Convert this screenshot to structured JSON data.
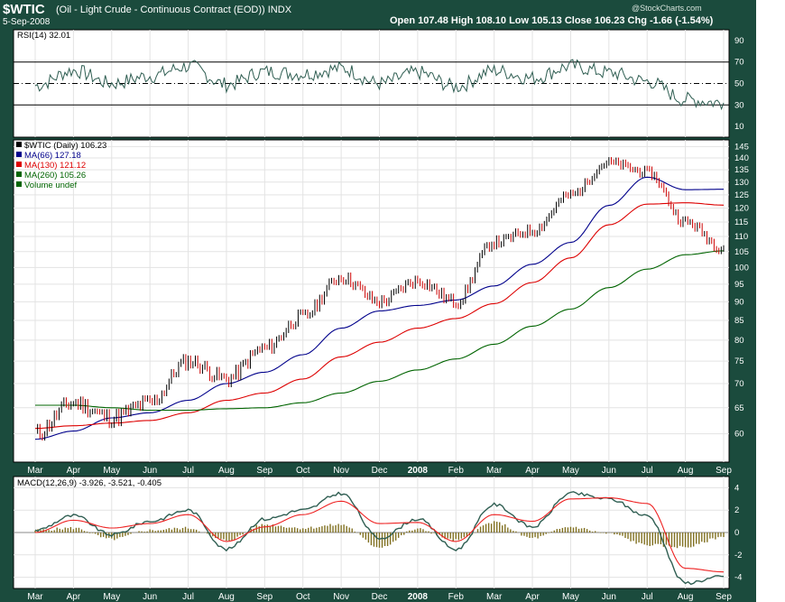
{
  "header": {
    "symbol": "$WTIC",
    "description": "(Oil - Light Crude - Continuous Contract (EOD)) INDX",
    "date": "5-Sep-2008",
    "credit": "@StockCharts.com",
    "quote": "Open 107.48  High 108.10  Low 105.13  Close 106.23  Chg -1.66 (-1.54%)"
  },
  "colors": {
    "frame": "#1b4b3d",
    "price_up": "#000000",
    "price_down": "#cc0000",
    "ma66": "#00008b",
    "ma130": "#dd0000",
    "ma260": "#006400",
    "rsi": "#2f5e52",
    "macd_signal": "#ee2222",
    "histogram": "#807020"
  },
  "chart_data": [
    {
      "type": "line",
      "panel": "rsi",
      "legend": "RSI(14) 32.01",
      "y_ticks": [
        10,
        30,
        50,
        70,
        90
      ],
      "reference_lines": [
        30,
        50,
        70
      ],
      "ylim": [
        0,
        100
      ],
      "x": [
        "Mar",
        "Apr",
        "May",
        "Jun",
        "Jul",
        "Aug",
        "Sep",
        "Oct",
        "Nov",
        "Dec",
        "2008",
        "Feb",
        "Mar",
        "Apr",
        "May",
        "Jun",
        "Jul",
        "Aug",
        "Sep"
      ],
      "series": [
        {
          "name": "RSI(14)",
          "values": [
            48,
            62,
            50,
            57,
            66,
            49,
            61,
            59,
            64,
            50,
            60,
            47,
            62,
            55,
            66,
            60,
            52,
            35,
            32
          ]
        }
      ]
    },
    {
      "type": "line",
      "panel": "price",
      "legend": [
        "$WTIC (Daily) 106.23",
        "MA(66) 127.18",
        "MA(130) 121.12",
        "MA(260) 105.26",
        "Volume undef"
      ],
      "x": [
        "Mar",
        "Apr",
        "May",
        "Jun",
        "Jul",
        "Aug",
        "Sep",
        "Oct",
        "Nov",
        "Dec",
        "2008",
        "Feb",
        "Mar",
        "Apr",
        "May",
        "Jun",
        "Jul",
        "Aug",
        "Sep"
      ],
      "y_ticks": [
        60,
        65,
        70,
        75,
        80,
        85,
        90,
        95,
        100,
        105,
        110,
        115,
        120,
        125,
        130,
        135,
        140,
        145
      ],
      "ylim": [
        55,
        148
      ],
      "log_scale": true,
      "series": [
        {
          "name": "$WTIC (Daily)",
          "values": [
            60,
            66,
            63,
            66,
            75,
            71,
            78,
            86,
            97,
            90,
            96,
            90,
            108,
            112,
            125,
            138,
            134,
            115,
            106.23
          ]
        },
        {
          "name": "MA(66)",
          "values": [
            59,
            60.5,
            63,
            64,
            66.5,
            70,
            72.5,
            76.5,
            83,
            87.5,
            89,
            90.5,
            94.5,
            101,
            108,
            121,
            132,
            127,
            127.18
          ]
        },
        {
          "name": "MA(130)",
          "values": [
            61,
            61.5,
            62,
            62.5,
            64,
            66.5,
            68,
            71,
            76,
            79.5,
            83,
            85.5,
            89.5,
            95.5,
            103,
            114,
            121.5,
            122,
            121.12
          ]
        },
        {
          "name": "MA(260)",
          "values": [
            65.5,
            65.5,
            65,
            64.5,
            64.5,
            64.8,
            65,
            66,
            68,
            70.5,
            73,
            75.5,
            79,
            83.5,
            88,
            94,
            99.5,
            104,
            105.26
          ]
        }
      ]
    },
    {
      "type": "line",
      "panel": "macd",
      "legend": "MACD(12,26,9) -3.926, -3.521, -0.405",
      "x": [
        "Mar",
        "Apr",
        "May",
        "Jun",
        "Jul",
        "Aug",
        "Sep",
        "Oct",
        "Nov",
        "Dec",
        "2008",
        "Feb",
        "Mar",
        "Apr",
        "May",
        "Jun",
        "Jul",
        "Aug",
        "Sep"
      ],
      "y_ticks": [
        -4,
        -2,
        0,
        2,
        4
      ],
      "ylim": [
        -5,
        5
      ],
      "series": [
        {
          "name": "MACD(12,26,9)",
          "values": [
            0.2,
            1.5,
            -0.2,
            1.0,
            2.0,
            -1.5,
            1.2,
            2.0,
            3.5,
            -0.5,
            1.2,
            -1.5,
            2.5,
            0.5,
            3.5,
            3.0,
            1.5,
            -4.5,
            -3.926
          ]
        },
        {
          "name": "Signal",
          "values": [
            0.0,
            1.1,
            0.4,
            0.8,
            1.6,
            -0.8,
            0.5,
            1.6,
            2.8,
            0.8,
            0.9,
            -0.8,
            1.6,
            1.0,
            3.0,
            3.1,
            2.6,
            -3.2,
            -3.521
          ]
        },
        {
          "name": "Histogram",
          "values": [
            0.2,
            0.4,
            -0.6,
            0.2,
            0.4,
            -0.7,
            0.7,
            0.4,
            0.7,
            -1.3,
            0.3,
            -0.7,
            0.9,
            -0.5,
            0.5,
            -0.1,
            -1.1,
            -1.3,
            -0.405
          ]
        }
      ]
    }
  ]
}
